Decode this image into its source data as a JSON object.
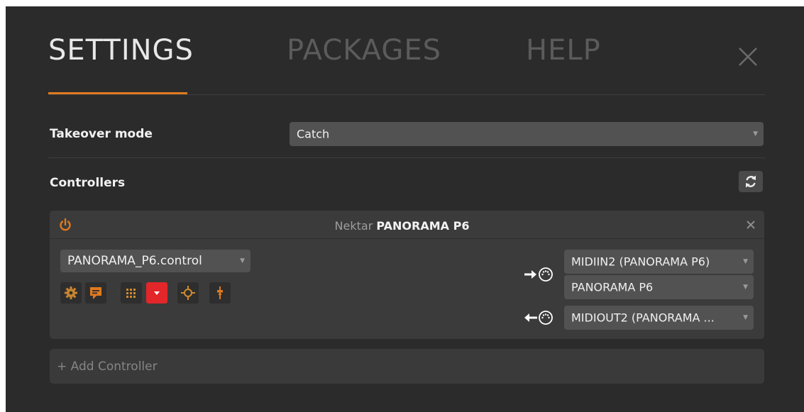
{
  "tabs": [
    {
      "label": "SETTINGS",
      "active": true
    },
    {
      "label": "PACKAGES",
      "active": false
    },
    {
      "label": "HELP",
      "active": false
    }
  ],
  "takeover": {
    "label": "Takeover mode",
    "value": "Catch"
  },
  "controllers": {
    "label": "Controllers",
    "device": {
      "vendor": "Nektar",
      "model": "PANORAMA P6"
    },
    "script": "PANORAMA_P6.control",
    "midi_in": [
      "MIDIIN2 (PANORAMA P6)",
      "PANORAMA P6"
    ],
    "midi_out": "MIDIOUT2 (PANORAMA ..."
  },
  "add_controller": {
    "plus": "+",
    "label": "Add Controller"
  },
  "colors": {
    "accent_orange": "#e07a1f",
    "warning_red": "#e2262a",
    "panel_bg": "#2b2b2b"
  },
  "icons": [
    "close-icon",
    "refresh-icon",
    "power-icon",
    "gear-icon",
    "comment-icon",
    "grid-icon",
    "dropdown-icon",
    "crosshair-icon",
    "fader-icon",
    "arrow-right-icon",
    "arrow-left-icon",
    "midi-port-icon"
  ]
}
